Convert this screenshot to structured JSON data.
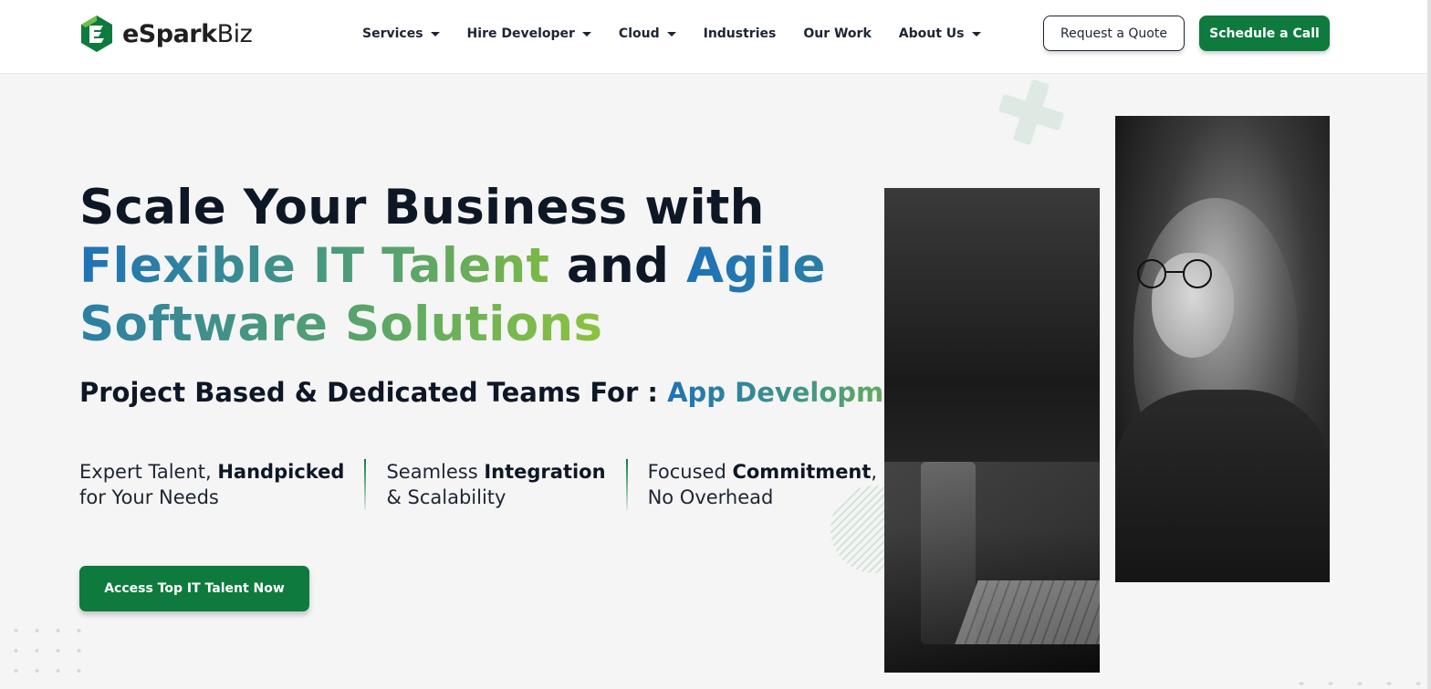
{
  "brand": {
    "name_bold": "eSpark",
    "name_light": "Biz",
    "accent": "#0e7a3d"
  },
  "nav": {
    "items": [
      {
        "label": "Services",
        "has_dropdown": true
      },
      {
        "label": "Hire Developer",
        "has_dropdown": true
      },
      {
        "label": "Cloud",
        "has_dropdown": true
      },
      {
        "label": "Industries",
        "has_dropdown": false
      },
      {
        "label": "Our Work",
        "has_dropdown": false
      },
      {
        "label": "About Us",
        "has_dropdown": true
      }
    ],
    "quote_label": "Request a Quote",
    "call_label": "Schedule a Call"
  },
  "hero": {
    "line1": "Scale Your Business with",
    "line2_a": "Flexible IT Talent",
    "line2_b": " and ",
    "line2_c": "Agile",
    "line3": "Software Solutions",
    "sub_prefix": "Project Based & Dedicated Teams For : ",
    "sub_rotating": "App Development",
    "features": [
      {
        "pre": "Expert Talent, ",
        "bold": "Handpicked",
        "post": "",
        "line2": "for Your Needs"
      },
      {
        "pre": "Seamless ",
        "bold": "Integration",
        "post": "",
        "line2": "& Scalability"
      },
      {
        "pre": "Focused ",
        "bold": "Commitment",
        "post": ",",
        "line2": "No Overhead"
      }
    ],
    "cta_label": "Access Top IT Talent Now"
  },
  "images": {
    "left_icon": "code-keyboard-photo",
    "right_icon": "woman-with-glasses-photo"
  }
}
